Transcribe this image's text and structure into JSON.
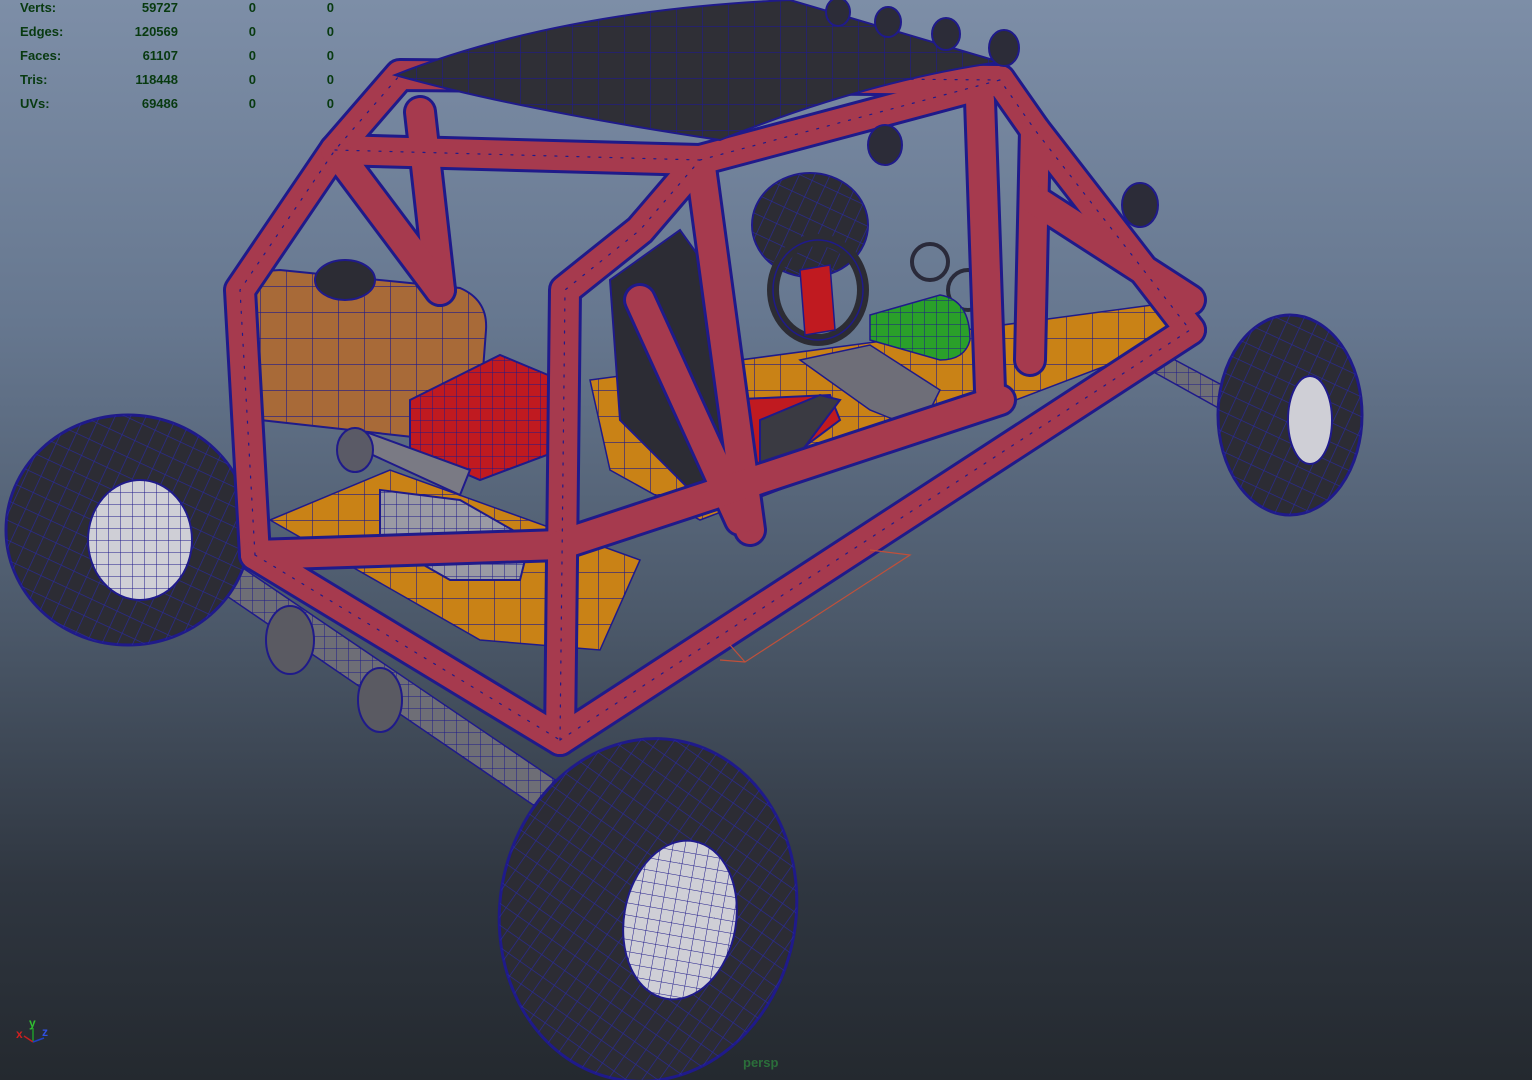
{
  "hud": {
    "rows": [
      {
        "label": "Verts:",
        "v1": "59727",
        "v2": "0",
        "v3": "0"
      },
      {
        "label": "Edges:",
        "v1": "120569",
        "v2": "0",
        "v3": "0"
      },
      {
        "label": "Faces:",
        "v1": "61107",
        "v2": "0",
        "v3": "0"
      },
      {
        "label": "Tris:",
        "v1": "118448",
        "v2": "0",
        "v3": "0"
      },
      {
        "label": "UVs:",
        "v1": "69486",
        "v2": "0",
        "v3": "0"
      }
    ]
  },
  "camera": "persp",
  "axis": {
    "x": "x",
    "y": "y",
    "z": "z"
  },
  "colors": {
    "frame": "#a63a4e",
    "wire": "#1f1a8a",
    "floor": "#c98216",
    "tire": "#2c2c34",
    "tank": "#a86a38",
    "engine": "#c01a20",
    "green": "#2aa02a",
    "rim": "#d4d4d8"
  }
}
